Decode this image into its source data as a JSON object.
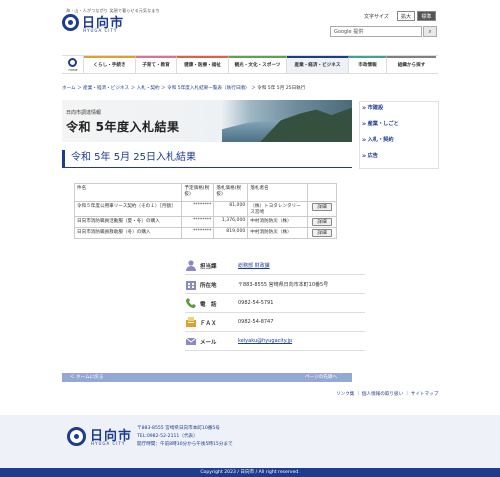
{
  "header": {
    "tagline": "海・山・人がつながり 笑顔で暮らせる元気なまち",
    "logo": "日向市",
    "logo_sub": "HYUGA CITY",
    "font_size_label": "文字サイズ",
    "font_large": "拡大",
    "font_standard": "標準",
    "search_brand": "Google 提供",
    "search_button_icon": "search-icon"
  },
  "nav": {
    "home": "HOME",
    "items": [
      "くらし・手続き",
      "子育て・教育",
      "健康・医療・福祉",
      "観光・文化・スポーツ",
      "産業・経済・ビジネス",
      "市政情報",
      "組織から探す"
    ],
    "colors": [
      "#e0a030",
      "#e07090",
      "#e06040",
      "#60a050",
      "#1d3c8f",
      "#40a0a0",
      "#808080"
    ]
  },
  "breadcrumb": {
    "items": [
      "ホーム",
      "産業・経済・ビジネス",
      "入札・契約",
      "令和 5年度入札結果一覧表（執行日順）"
    ],
    "current": "令和 5年 5月 25日執行"
  },
  "banner": {
    "sub": "日向市調達情報",
    "title": "令和 5年度入札結果"
  },
  "page_title": "令和 5年 5月 25日入札結果",
  "sidebar": {
    "items": [
      "市建設",
      "産業・しごと",
      "入札・契約",
      "広告"
    ]
  },
  "table": {
    "headers": [
      "件名",
      "予定価格(税抜)",
      "落札価格(税抜)",
      "落札者名",
      ""
    ],
    "rows": [
      {
        "name": "令和５年度公用車リース契約（その１）［月額］",
        "planned": "********",
        "winning": "81,000",
        "winner": "（株）トヨタレンタリース宮崎",
        "button": "詳細"
      },
      {
        "name": "日向市消防職員活動服（夏・冬）の購入",
        "planned": "********",
        "winning": "1,376,000",
        "winner": "中村消防防災（株）",
        "button": "詳細"
      },
      {
        "name": "日向市消防職員救助服（冬）の購入",
        "planned": "********",
        "winning": "819,000",
        "winner": "中村消防防災（株）",
        "button": "詳細"
      }
    ]
  },
  "contact": {
    "dept_label": "担当課",
    "dept_value": "総務部 財政課",
    "address_label": "所在地",
    "address_value": "〒883-8555 宮崎県日向市本町10番5号",
    "phone_label": "電　話",
    "phone_value": "0982-54-5791",
    "fax_label": "ＦＡＸ",
    "fax_value": "0982-54-8747",
    "mail_label": "メール",
    "mail_value": "keiyaku@hyugacity.jp"
  },
  "pagebar": {
    "left": "＜ ホームに戻る",
    "right": "ページの先頭へ ＾"
  },
  "footer_links": "リンク集 ｜ 個人情報の取り扱い ｜ サイトマップ",
  "footer": {
    "logo": "日向市",
    "logo_sub": "HYUGA CITY",
    "address": "〒883-8555 宮崎県日向市本町10番5号",
    "tel": "TEL:0982-52-2111（代表）",
    "hours": "開庁時間：午前8時30分から午後5時15分まで"
  },
  "copyright": "Copyright 2023 / 日向市 / All right reserved."
}
